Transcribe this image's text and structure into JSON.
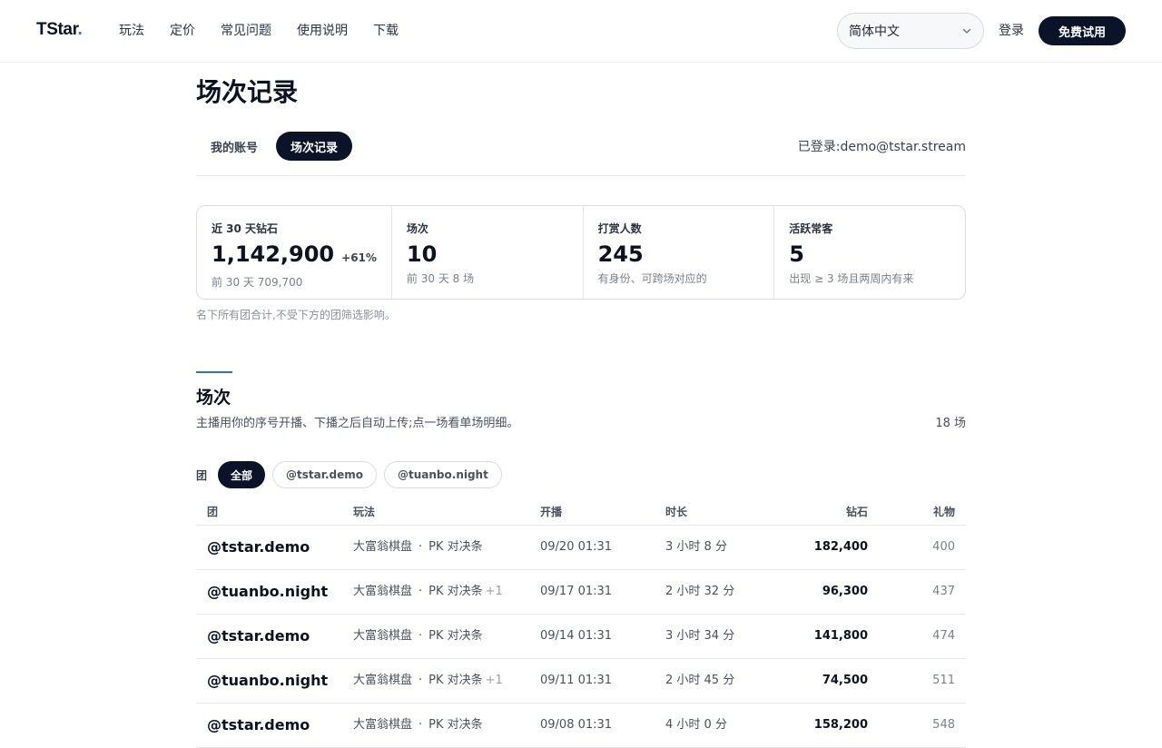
{
  "nav": {
    "logo_text": "TStar",
    "logo_dot": ".",
    "links": [
      "玩法",
      "定价",
      "常见问题",
      "使用说明",
      "下载"
    ],
    "language": "简体中文",
    "login": "登录",
    "trial": "免费试用"
  },
  "page": {
    "title": "场次记录",
    "tabs": [
      {
        "label": "我的账号",
        "active": false
      },
      {
        "label": "场次记录",
        "active": true
      }
    ],
    "logged_in": "已登录:demo@tstar.stream"
  },
  "stats": {
    "cards": [
      {
        "label": "近 30 天钻石",
        "value": "1,142,900",
        "delta": "+61%",
        "sub": "前 30 天 709,700"
      },
      {
        "label": "场次",
        "value": "10",
        "delta": "",
        "sub": "前 30 天 8 场"
      },
      {
        "label": "打赏人数",
        "value": "245",
        "delta": "",
        "sub": "有身份、可跨场对应的"
      },
      {
        "label": "活跃常客",
        "value": "5",
        "delta": "",
        "sub": "出现 ≥ 3 场且两周内有来"
      }
    ],
    "note": "名下所有团合计,不受下方的团筛选影响。"
  },
  "sessions": {
    "title": "场次",
    "description": "主播用你的序号开播、下播之后自动上传;点一场看单场明细。",
    "count": "18 场",
    "filter": {
      "label": "团",
      "chips": [
        {
          "label": "全部",
          "active": true
        },
        {
          "label": "@tstar.demo",
          "active": false
        },
        {
          "label": "@tuanbo.night",
          "active": false
        }
      ]
    },
    "table": {
      "headers": {
        "team": "团",
        "play": "玩法",
        "start": "开播",
        "duration": "时长",
        "diamonds": "钻石",
        "gifts": "礼物"
      },
      "rows": [
        {
          "team": "@tstar.demo",
          "play_a": "大富翁棋盘",
          "sep": "·",
          "play_b": "PK 对决条",
          "extra": "",
          "start": "09/20 01:31",
          "duration": "3 小时 8 分",
          "diamonds": "182,400",
          "gifts": "400"
        },
        {
          "team": "@tuanbo.night",
          "play_a": "大富翁棋盘",
          "sep": "·",
          "play_b": "PK 对决条",
          "extra": "+1",
          "start": "09/17 01:31",
          "duration": "2 小时 32 分",
          "diamonds": "96,300",
          "gifts": "437"
        },
        {
          "team": "@tstar.demo",
          "play_a": "大富翁棋盘",
          "sep": "·",
          "play_b": "PK 对决条",
          "extra": "",
          "start": "09/14 01:31",
          "duration": "3 小时 34 分",
          "diamonds": "141,800",
          "gifts": "474"
        },
        {
          "team": "@tuanbo.night",
          "play_a": "大富翁棋盘",
          "sep": "·",
          "play_b": "PK 对决条",
          "extra": "+1",
          "start": "09/11 01:31",
          "duration": "2 小时 45 分",
          "diamonds": "74,500",
          "gifts": "511"
        },
        {
          "team": "@tstar.demo",
          "play_a": "大富翁棋盘",
          "sep": "·",
          "play_b": "PK 对决条",
          "extra": "",
          "start": "09/08 01:31",
          "duration": "4 小时 0 分",
          "diamonds": "158,200",
          "gifts": "548"
        }
      ]
    }
  }
}
